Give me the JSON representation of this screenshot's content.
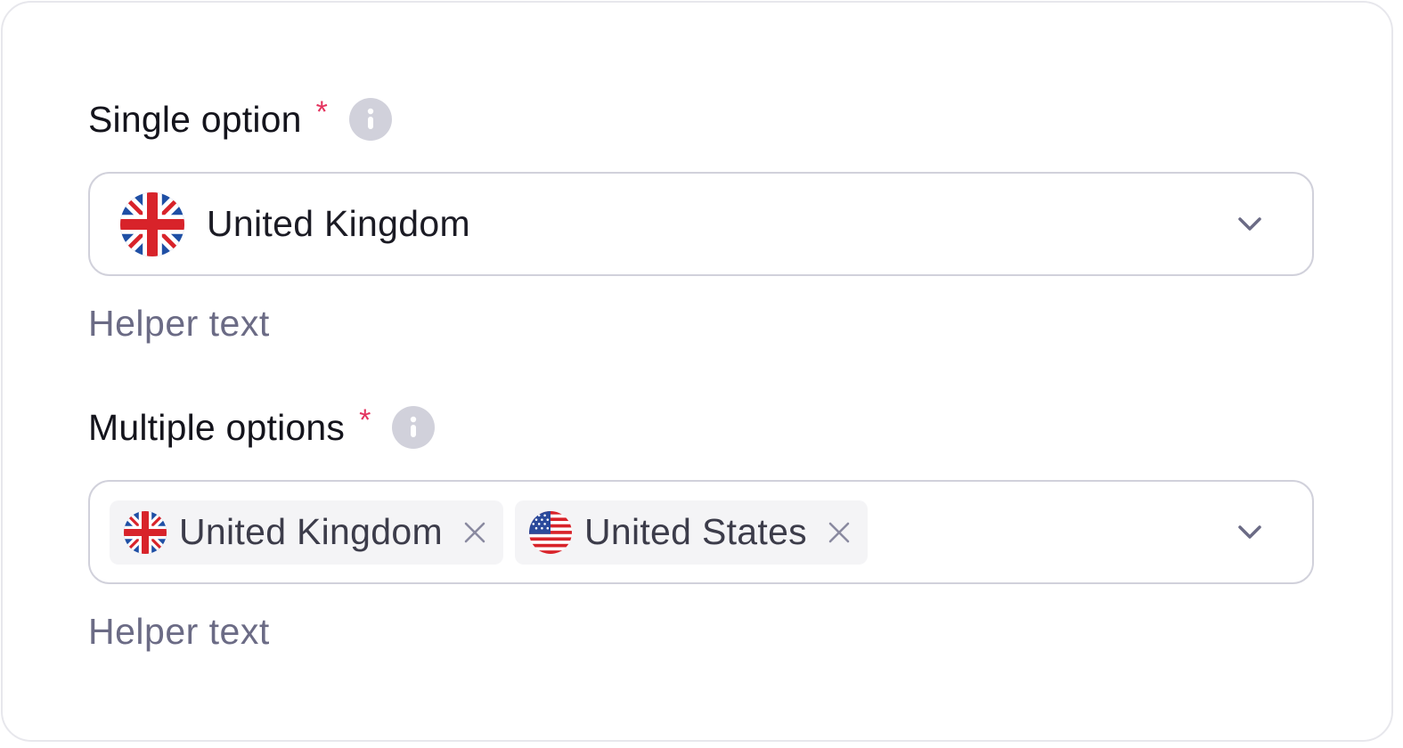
{
  "single": {
    "label": "Single option",
    "required_mark": "*",
    "selected": {
      "label": "United Kingdom",
      "flag": "uk-flag-icon"
    },
    "helper": "Helper text"
  },
  "multi": {
    "label": "Multiple options",
    "required_mark": "*",
    "chips": [
      {
        "label": "United Kingdom",
        "flag": "uk-flag-icon"
      },
      {
        "label": "United States",
        "flag": "us-flag-icon"
      }
    ],
    "helper": "Helper text"
  },
  "colors": {
    "required": "#e4335e",
    "border": "#d1d1db",
    "helper": "#6b6b85",
    "chip_bg": "#f4f4f6",
    "info_icon_bg": "#d1d1db"
  },
  "icons": {
    "info": "info-icon",
    "dropdown": "chevron-down-icon",
    "remove": "close-icon"
  }
}
